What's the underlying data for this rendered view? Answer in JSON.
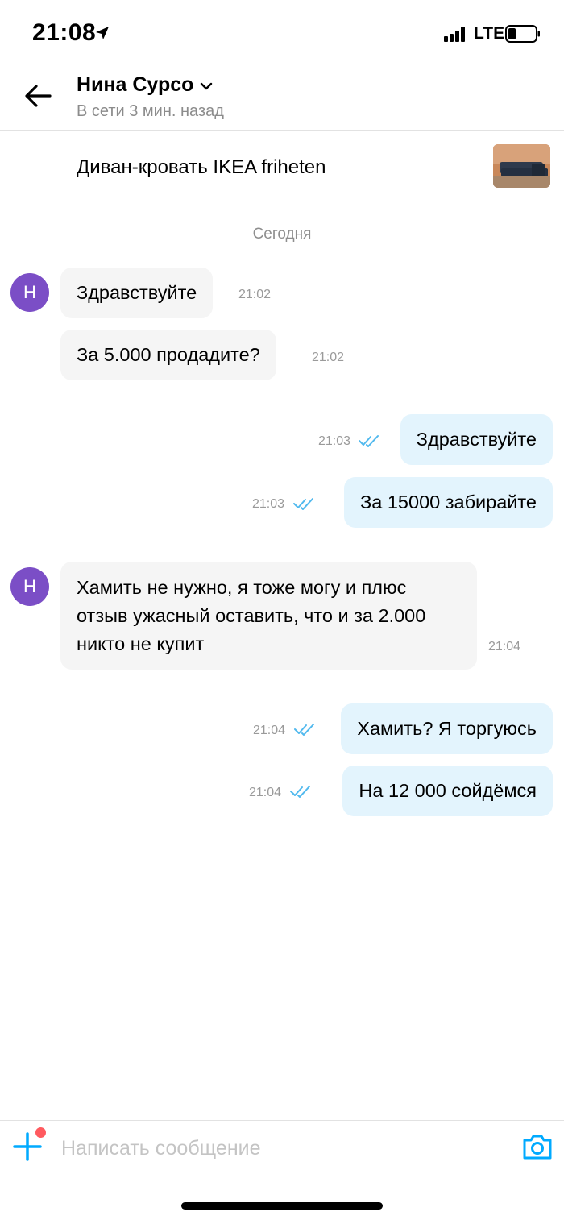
{
  "status_bar": {
    "time": "21:08",
    "network": "LTE",
    "icons": [
      "location-arrow-icon",
      "signal-icon",
      "battery-icon"
    ]
  },
  "header": {
    "name": "Нина Сурсо",
    "status": "В сети 3 мин. назад",
    "icons": [
      "back-arrow-icon",
      "chevron-down-icon"
    ]
  },
  "item": {
    "title": "Диван-кровать IKEA friheten"
  },
  "chat": {
    "day_label": "Сегодня",
    "avatar_letter": "Н",
    "messages": [
      {
        "direction": "in",
        "text": "Здравствуйте",
        "time": "21:02"
      },
      {
        "direction": "in",
        "text": "За 5.000 продадите?",
        "time": "21:02"
      },
      {
        "direction": "out",
        "text": "Здравствуйте",
        "time": "21:03",
        "read": true
      },
      {
        "direction": "out",
        "text": "За 15000 забирайте",
        "time": "21:03",
        "read": true
      },
      {
        "direction": "in",
        "text": "Хамить не нужно, я тоже могу и плюс отзыв ужасный оставить, что и за 2.000 никто не купит",
        "time": "21:04"
      },
      {
        "direction": "out",
        "text": "Хамить? Я торгуюсь",
        "time": "21:04",
        "read": true
      },
      {
        "direction": "out",
        "text": "На 12 000 сойдёмся",
        "time": "21:04",
        "read": true
      }
    ]
  },
  "composer": {
    "placeholder": "Написать сообщение",
    "value": "",
    "icons": [
      "plus-icon",
      "camera-icon"
    ]
  },
  "colors": {
    "accent": "#00aaff",
    "avatar": "#7b4ec6",
    "incoming_bubble": "#f5f5f5",
    "outgoing_bubble": "#e3f4fd",
    "notification_dot": "#ff5a5f"
  }
}
